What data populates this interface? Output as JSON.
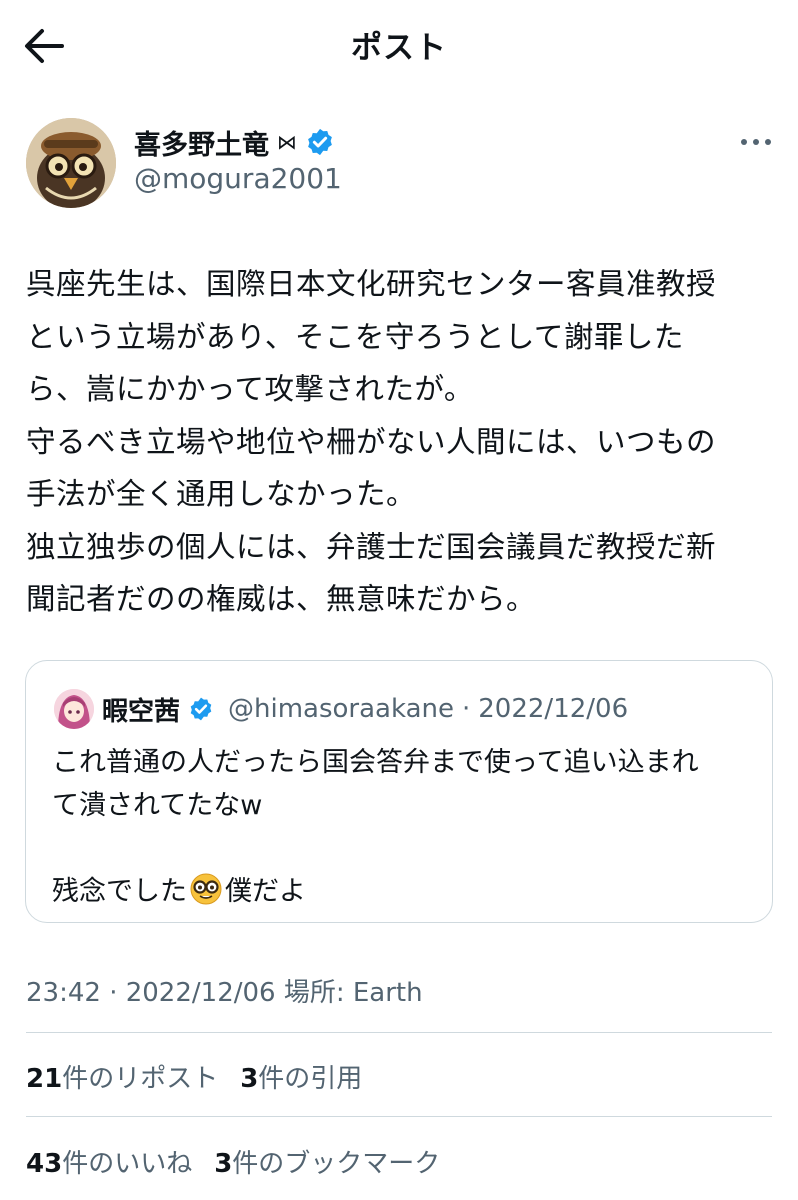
{
  "header": {
    "title": "ポスト"
  },
  "author": {
    "display_name": "喜多野土竜",
    "badge": "⋈",
    "handle": "@mogura2001",
    "verified": true
  },
  "post": {
    "lines": [
      "呉座先生は、国際日本文化研究センター客員准教授",
      "という立場があり、そこを守ろうとして謝罪した",
      "ら、嵩にかかって攻撃されたが。",
      "守るべき立場や地位や柵がない人間には、いつもの",
      "手法が全く通用しなかった。",
      "独立独歩の個人には、弁護士だ国会議員だ教授だ新",
      "聞記者だのの権威は、無意味だから。"
    ]
  },
  "quote": {
    "display_name": "暇空茜",
    "handle": "@himasoraakane",
    "separator": "·",
    "date": "2022/12/06",
    "line1": "これ普通の人だったら国会答弁まで使って追い込まれ",
    "line2": "て潰されてたなw",
    "line3_before": "残念でした",
    "emoji_icon": "nerd-face-icon",
    "line3_after": "僕だよ"
  },
  "meta": {
    "text": "23:42 · 2022/12/06 場所: Earth"
  },
  "stats": {
    "reposts_num": "21",
    "reposts_label": "件のリポスト",
    "quotes_num": "3",
    "quotes_label": "件の引用",
    "likes_num": "43",
    "likes_label": "件のいいね",
    "bookmarks_num": "3",
    "bookmarks_label": "件のブックマーク"
  },
  "colors": {
    "text": "#0f1419",
    "secondary": "#536471",
    "verified": "#1d9bf0",
    "border": "#cfd9de"
  }
}
